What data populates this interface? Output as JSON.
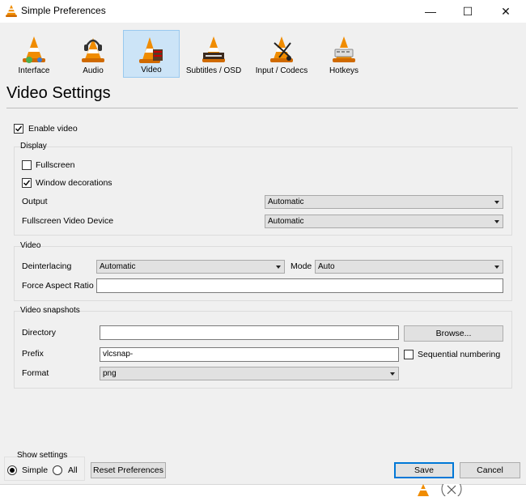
{
  "window": {
    "title": "Simple Preferences",
    "minimize": "—",
    "maximize": "☐",
    "close": "✕"
  },
  "toolbar": {
    "items": [
      {
        "label": "Interface",
        "icon": "interface-cone-icon"
      },
      {
        "label": "Audio",
        "icon": "audio-headphones-cone-icon"
      },
      {
        "label": "Video",
        "icon": "video-cone-icon",
        "active": true
      },
      {
        "label": "Subtitles / OSD",
        "icon": "subtitles-cone-icon"
      },
      {
        "label": "Input / Codecs",
        "icon": "codecs-cone-icon"
      },
      {
        "label": "Hotkeys",
        "icon": "hotkeys-cone-icon"
      }
    ]
  },
  "page": {
    "heading": "Video Settings"
  },
  "enable_video": {
    "label": "Enable video",
    "checked": true
  },
  "display": {
    "title": "Display",
    "fullscreen": {
      "label": "Fullscreen",
      "checked": false
    },
    "window_decorations": {
      "label": "Window decorations",
      "checked": true
    },
    "output": {
      "label": "Output",
      "value": "Automatic"
    },
    "fullscreen_device": {
      "label": "Fullscreen Video Device",
      "value": "Automatic"
    }
  },
  "video": {
    "title": "Video",
    "deinterlacing": {
      "label": "Deinterlacing",
      "value": "Automatic"
    },
    "mode": {
      "label": "Mode",
      "value": "Auto"
    },
    "aspect_ratio": {
      "label": "Force Aspect Ratio",
      "value": ""
    }
  },
  "snapshots": {
    "title": "Video snapshots",
    "directory": {
      "label": "Directory",
      "value": "",
      "browse": "Browse..."
    },
    "prefix": {
      "label": "Prefix",
      "value": "vlcsnap-"
    },
    "sequential": {
      "label": "Sequential numbering",
      "checked": false
    },
    "format": {
      "label": "Format",
      "value": "png"
    }
  },
  "footer": {
    "show_settings": "Show settings",
    "simple": "Simple",
    "all": "All",
    "selected": "Simple",
    "reset": "Reset Preferences",
    "save": "Save",
    "cancel": "Cancel"
  },
  "colors": {
    "accent": "#0078d7",
    "cone_orange": "#f08c00",
    "active_tab": "#cce4f7"
  }
}
